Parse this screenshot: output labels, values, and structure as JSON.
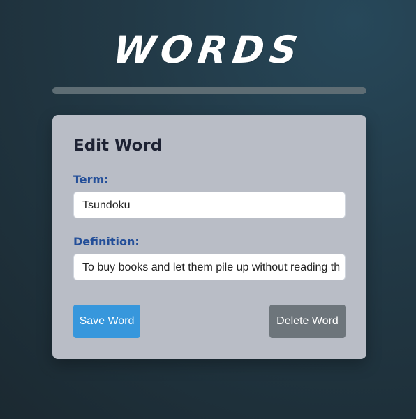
{
  "header": {
    "title": "WORDS"
  },
  "edit_form": {
    "heading": "Edit Word",
    "term_label": "Term:",
    "term_value": "Tsundoku",
    "definition_label": "Definition:",
    "definition_value": "To buy books and let them pile up without reading th",
    "save_button_label": "Save Word",
    "delete_button_label": "Delete Word"
  },
  "theme": {
    "save_color": "#3797dc",
    "delete_color": "#6d757b",
    "label_color": "#244f99"
  }
}
